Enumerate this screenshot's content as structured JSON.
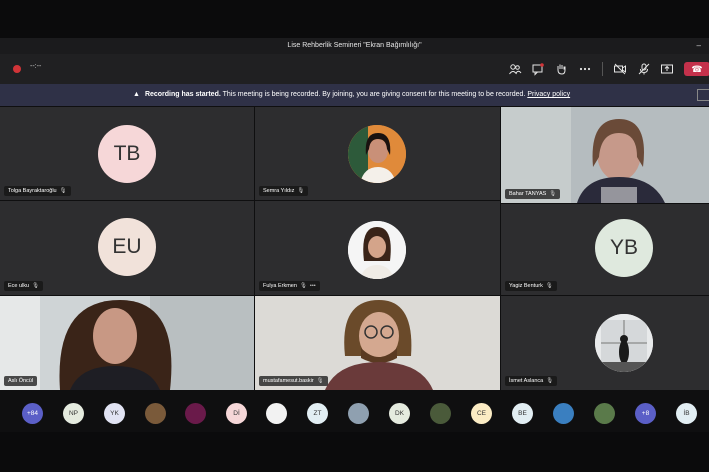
{
  "window": {
    "title": "Lise Rehberlik Semineri \"Ekran Bağımlılığı\"",
    "minimize_glyph": "–"
  },
  "controls": {
    "timer": "--:--",
    "icons": [
      "participants-icon",
      "chat-icon",
      "raise-hand-icon",
      "more-icon",
      "camera-off-icon",
      "mic-off-icon",
      "share-screen-icon"
    ],
    "hangup_glyph": "☎"
  },
  "banner": {
    "bold": "Recording has started.",
    "text": "This meeting is being recorded. By joining, you are giving consent for this meeting to be recorded.",
    "link": "Privacy policy"
  },
  "tiles": [
    {
      "name": "Tolga Bayraktaroğlu",
      "initials": "TB",
      "avatar_color": "#f6d7d8"
    },
    {
      "name": "Semra Yıldız",
      "initials": ""
    },
    {
      "name": "Bahar TANYAS",
      "initials": ""
    },
    {
      "name": "Ece ulku",
      "initials": "EU",
      "avatar_color": "#f1e2da"
    },
    {
      "name": "Fulya Erkmen",
      "initials": "",
      "more": "•••"
    },
    {
      "name": "Yagiz Benturk",
      "initials": "YB",
      "avatar_color": "#dfe9de"
    },
    {
      "name": "Aslı Öncül",
      "initials": ""
    },
    {
      "name": "mustafamesut.baskir",
      "initials": ""
    },
    {
      "name": "İsmet Aslanca",
      "initials": ""
    }
  ],
  "roster": [
    {
      "label": "+84",
      "color": "#5b5fc7",
      "text_color": "#fff"
    },
    {
      "label": "NP",
      "color": "#e5ebdf"
    },
    {
      "label": "YK",
      "color": "#e1e3f3"
    },
    {
      "label": "",
      "color": "#7a5a3a"
    },
    {
      "label": "",
      "color": "#6a1a4a"
    },
    {
      "label": "Dİ",
      "color": "#f6d7d8"
    },
    {
      "label": "",
      "color": "#f2f2f2"
    },
    {
      "label": "ZT",
      "color": "#e2eef3"
    },
    {
      "label": "",
      "color": "#8fa0b0"
    },
    {
      "label": "DK",
      "color": "#e5ebdf"
    },
    {
      "label": "",
      "color": "#4a5a3a"
    },
    {
      "label": "CE",
      "color": "#fbecc4"
    },
    {
      "label": "BE",
      "color": "#e2eef3"
    },
    {
      "label": "",
      "color": "#3a7fc0"
    },
    {
      "label": "",
      "color": "#5a7a4a"
    },
    {
      "label": "+8",
      "color": "#5b5fc7",
      "text_color": "#fff"
    },
    {
      "label": "İB",
      "color": "#e2eef3"
    }
  ]
}
